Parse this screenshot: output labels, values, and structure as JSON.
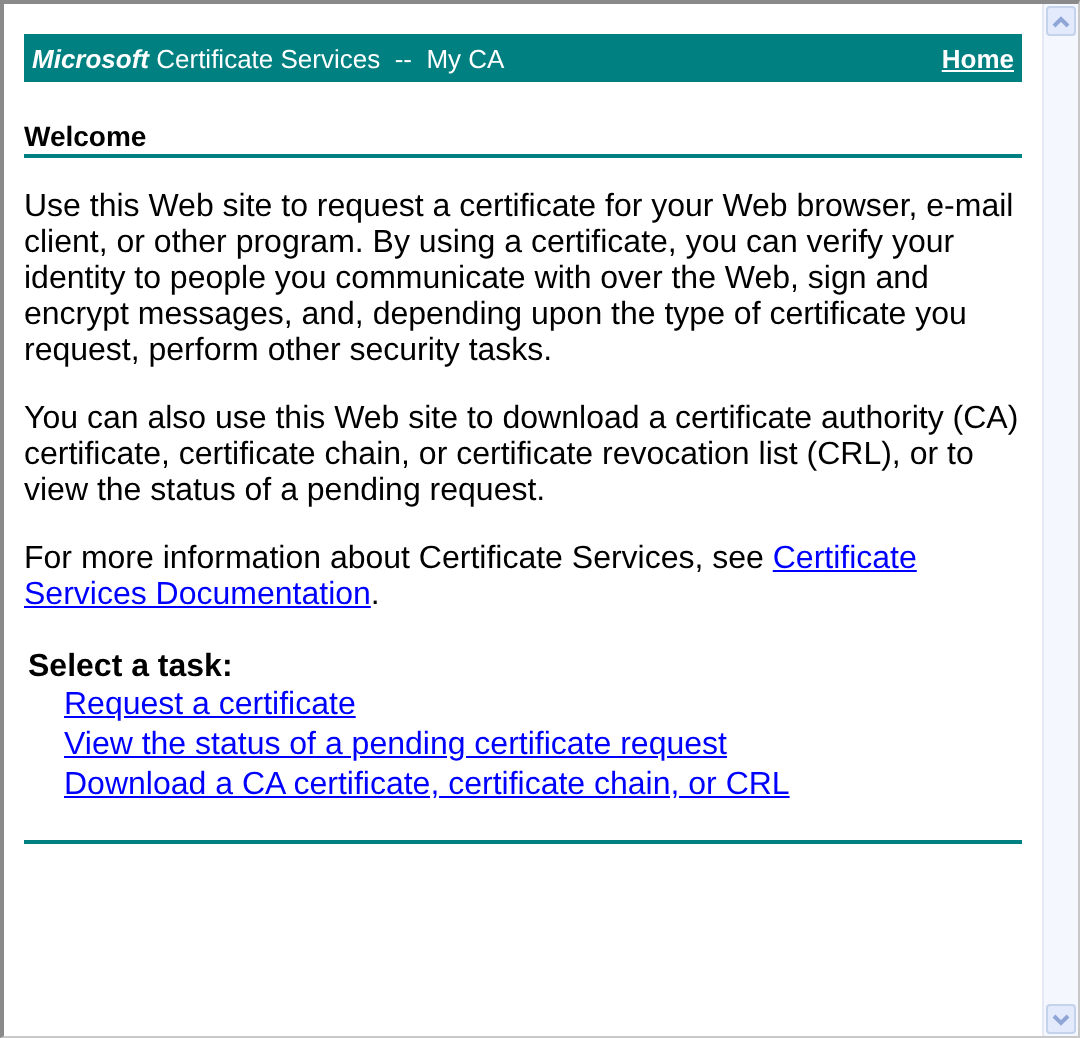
{
  "header": {
    "brand": "Microsoft",
    "title": "Certificate Services  --  My CA",
    "home_link": "Home"
  },
  "heading": "Welcome",
  "paragraphs": [
    "Use this Web site to request a certificate for your Web browser, e-mail client, or other program. By using a certificate, you can verify your identity to people you communicate with over the Web, sign and encrypt messages, and, depending upon the type of certificate you request, perform other security tasks.",
    "You can also use this Web site to download a certificate authority (CA) certificate, certificate chain, or certificate revocation list (CRL), or to view the status of a pending request."
  ],
  "more_info": {
    "text": "For more information about Certificate Services, see ",
    "link_lines": [
      "Certificate",
      "Services Documentation"
    ],
    "after": "."
  },
  "tasks": {
    "label": "Select a task:",
    "links": [
      "Request a certificate",
      "View the status of a pending certificate request",
      "Download a CA certificate, certificate chain, or CRL"
    ]
  }
}
